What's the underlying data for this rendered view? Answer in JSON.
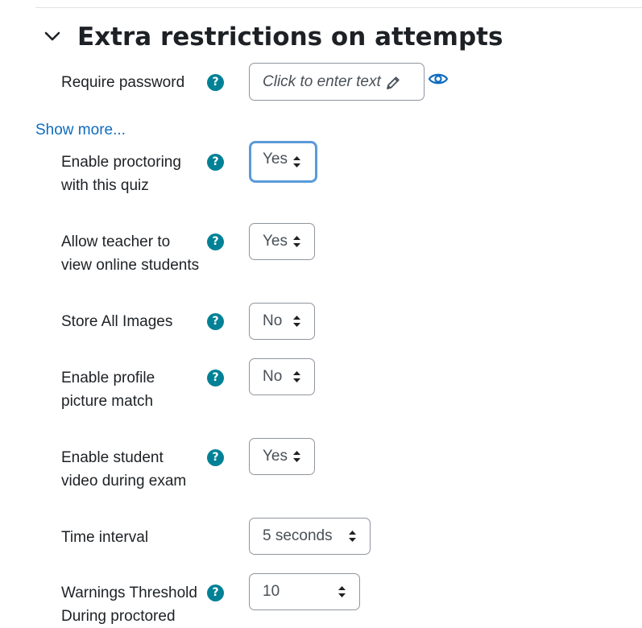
{
  "section": {
    "title": "Extra restrictions on attempts"
  },
  "password": {
    "label": "Require password",
    "placeholder": "Click to enter text"
  },
  "show_more": "Show more...",
  "fields": [
    {
      "label_line1": "Enable proctoring",
      "label_line2": "with this quiz",
      "value": "Yes"
    },
    {
      "label_line1": "Allow teacher to",
      "label_line2": "view online students",
      "value": "Yes"
    },
    {
      "label_line1": "Store All Images",
      "value": "No"
    },
    {
      "label_line1": "Enable profile",
      "label_line2": "picture match",
      "value": "No"
    },
    {
      "label_line1": "Enable student",
      "label_line2": "video during exam",
      "value": "Yes"
    },
    {
      "label_line1": "Time interval",
      "value": "5 seconds"
    },
    {
      "label_line1": "Warnings Threshold",
      "label_line2": "During proctored",
      "value": "10"
    }
  ],
  "help_glyph": "?",
  "colors": {
    "help_icon": "#008196",
    "link": "#0f6cbf",
    "focus_border": "#5a9ad9",
    "field_border": "#8f959e"
  }
}
